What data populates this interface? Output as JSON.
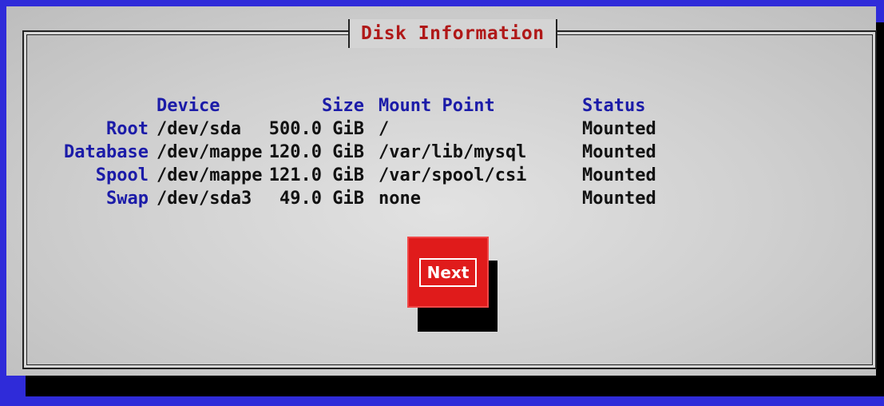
{
  "dialog": {
    "title": "Disk Information"
  },
  "table": {
    "headers": {
      "device": "Device",
      "size": "Size",
      "mount": "Mount Point",
      "status": "Status"
    },
    "rows": [
      {
        "label": "Root",
        "device": "/dev/sda",
        "size": "500.0 GiB",
        "mount": "/",
        "status": "Mounted"
      },
      {
        "label": "Database",
        "device": "/dev/mappe",
        "size": "120.0 GiB",
        "mount": "/var/lib/mysql",
        "status": "Mounted"
      },
      {
        "label": "Spool",
        "device": "/dev/mappe",
        "size": "121.0 GiB",
        "mount": "/var/spool/csi",
        "status": "Mounted"
      },
      {
        "label": "Swap",
        "device": "/dev/sda3",
        "size": "49.0 GiB",
        "mount": "none",
        "status": "Mounted"
      }
    ]
  },
  "buttons": {
    "next_label": "Next"
  },
  "colors": {
    "background": "#2f2bd9",
    "dialog": "#cfcfcf",
    "title": "#b01818",
    "label": "#1b1ba8",
    "button": "#e01b1b"
  }
}
